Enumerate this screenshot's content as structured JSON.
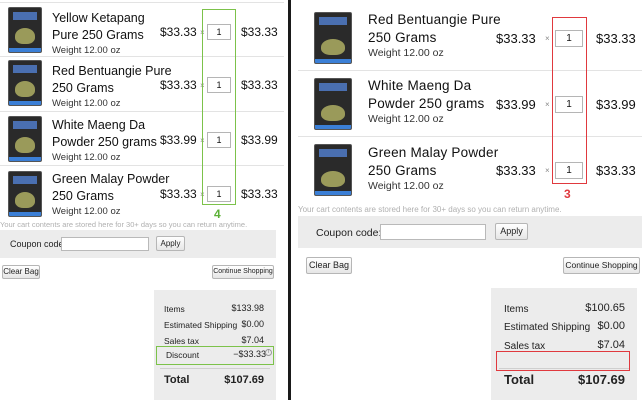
{
  "left": {
    "items": [
      {
        "name_line1": "Yellow Ketapang",
        "name_line2": "Pure 250 Grams",
        "weight": "Weight 12.00 oz",
        "price": "$33.33",
        "qty": "1",
        "total": "$33.33"
      },
      {
        "name_line1": "Red Bentuangie Pure",
        "name_line2": "250 Grams",
        "weight": "Weight 12.00 oz",
        "price": "$33.33",
        "qty": "1",
        "total": "$33.33"
      },
      {
        "name_line1": "White Maeng Da",
        "name_line2": "Powder 250 grams",
        "weight": "Weight 12.00 oz",
        "price": "$33.99",
        "qty": "1",
        "total": "$33.99"
      },
      {
        "name_line1": "Green Malay Powder",
        "name_line2": "250 Grams",
        "weight": "Weight 12.00 oz",
        "price": "$33.33",
        "qty": "1",
        "total": "$33.33"
      }
    ],
    "times": "×",
    "annotation": "4",
    "storage_note": "Your cart contents are stored here for 30+ days so you can return anytime.",
    "coupon_label": "Coupon code:",
    "apply_label": "Apply",
    "clear_label": "Clear Bag",
    "continue_label": "Continue Shopping",
    "summary": {
      "items_label": "Items",
      "items_value": "$133.98",
      "shipping_label": "Estimated Shipping",
      "shipping_value": "$0.00",
      "tax_label": "Sales tax",
      "tax_value": "$7.04",
      "discount_label": "Discount",
      "discount_value": "−$33.33",
      "info_glyph": "i",
      "total_label": "Total",
      "total_value": "$107.69"
    }
  },
  "right": {
    "items": [
      {
        "name_line1": "Red Bentuangie Pure",
        "name_line2": "250 Grams",
        "weight": "Weight 12.00 oz",
        "price": "$33.33",
        "qty": "1",
        "total": "$33.33"
      },
      {
        "name_line1": "White Maeng Da",
        "name_line2": "Powder 250 grams",
        "weight": "Weight 12.00 oz",
        "price": "$33.99",
        "qty": "1",
        "total": "$33.99"
      },
      {
        "name_line1": "Green Malay Powder",
        "name_line2": "250 Grams",
        "weight": "Weight 12.00 oz",
        "price": "$33.33",
        "qty": "1",
        "total": "$33.33"
      }
    ],
    "times": "×",
    "annotation": "3",
    "storage_note": "Your cart contents are stored here for 30+ days so you can return anytime.",
    "coupon_label": "Coupon code:",
    "apply_label": "Apply",
    "clear_label": "Clear Bag",
    "continue_label": "Continue Shopping",
    "summary": {
      "items_label": "Items",
      "items_value": "$100.65",
      "shipping_label": "Estimated Shipping",
      "shipping_value": "$0.00",
      "tax_label": "Sales tax",
      "tax_value": "$7.04",
      "total_label": "Total",
      "total_value": "$107.69"
    }
  },
  "colors": {
    "highlight_left": "#7cc24a",
    "highlight_right": "#e0393e",
    "panel_gray": "#ececec",
    "divider": "#1a1a1a"
  },
  "icons": {
    "product_thumbnail": "kratom-powder-bag-icon",
    "info": "info-circle-icon"
  }
}
